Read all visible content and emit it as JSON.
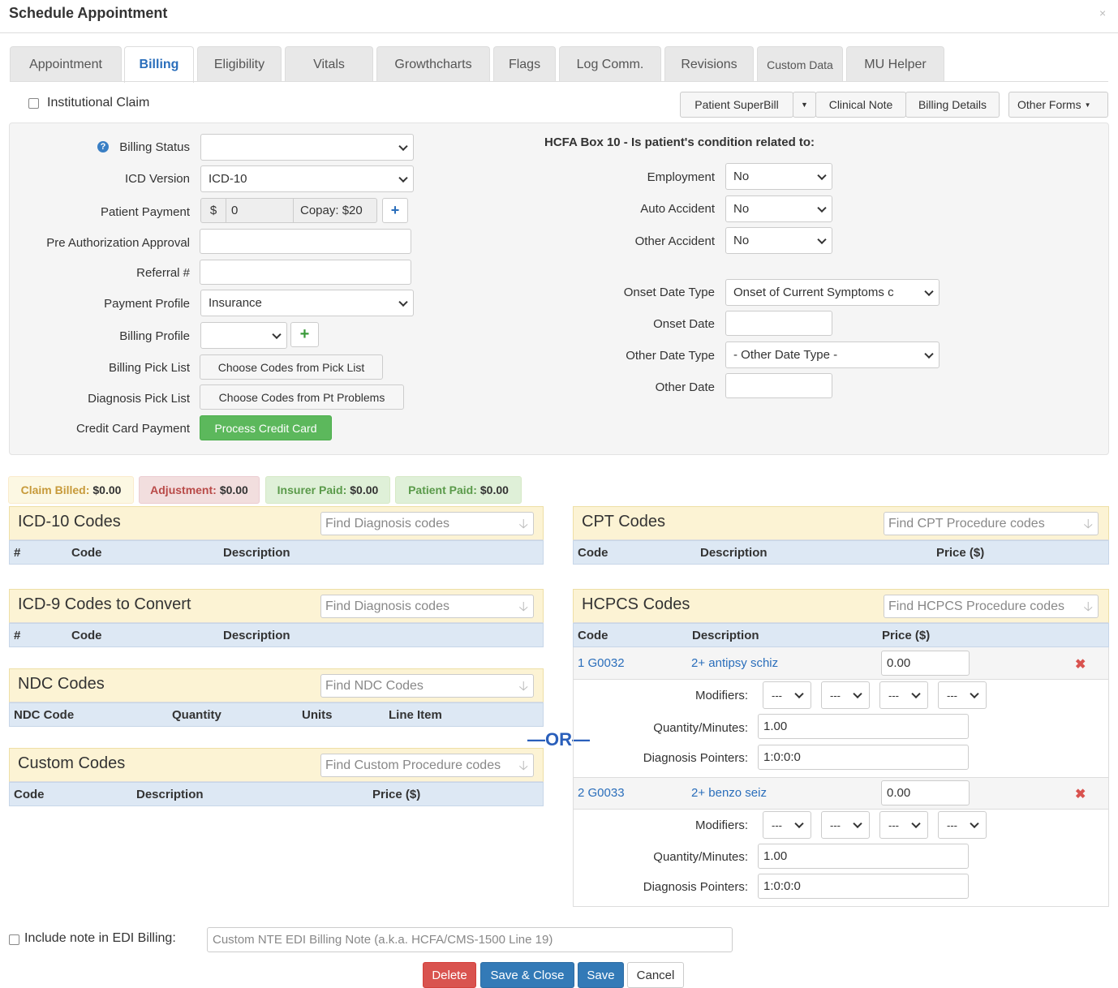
{
  "window": {
    "title": "Schedule Appointment",
    "close": "×"
  },
  "tabs": [
    {
      "label": "Appointment"
    },
    {
      "label": "Billing"
    },
    {
      "label": "Eligibility"
    },
    {
      "label": "Vitals"
    },
    {
      "label": "Growthcharts"
    },
    {
      "label": "Flags"
    },
    {
      "label": "Log Comm."
    },
    {
      "label": "Revisions"
    },
    {
      "label": "Custom Data"
    },
    {
      "label": "MU Helper"
    }
  ],
  "institutional_claim": "Institutional Claim",
  "toolbar": {
    "superbill": "Patient SuperBill",
    "clinical_note": "Clinical Note",
    "billing_details": "Billing Details",
    "other_forms": "Other Forms"
  },
  "form": {
    "billing_status": {
      "label": "Billing Status",
      "value": ""
    },
    "icd_version": {
      "label": "ICD Version",
      "value": "ICD-10"
    },
    "patient_payment": {
      "label": "Patient Payment",
      "currency": "$",
      "value": "0",
      "copay": "Copay: $20",
      "add": "+"
    },
    "pre_auth": {
      "label": "Pre Authorization Approval",
      "value": ""
    },
    "referral": {
      "label": "Referral #",
      "value": ""
    },
    "payment_profile": {
      "label": "Payment Profile",
      "value": "Insurance"
    },
    "billing_profile": {
      "label": "Billing Profile",
      "value": "",
      "add": "+"
    },
    "billing_pick_list": {
      "label": "Billing Pick List",
      "button": "Choose Codes from Pick List"
    },
    "diagnosis_pick_list": {
      "label": "Diagnosis Pick List",
      "button": "Choose Codes from Pt Problems"
    },
    "credit_card": {
      "label": "Credit Card Payment",
      "button": "Process Credit Card"
    }
  },
  "hcfa": {
    "heading": "HCFA Box 10 - Is patient's condition related to:",
    "employment": {
      "label": "Employment",
      "value": "No"
    },
    "auto_accident": {
      "label": "Auto Accident",
      "value": "No"
    },
    "other_accident": {
      "label": "Other Accident",
      "value": "No"
    },
    "onset_date_type": {
      "label": "Onset Date Type",
      "value": "Onset of Current Symptoms c"
    },
    "onset_date": {
      "label": "Onset Date",
      "value": ""
    },
    "other_date_type": {
      "label": "Other Date Type",
      "value": "- Other Date Type -"
    },
    "other_date": {
      "label": "Other Date",
      "value": ""
    }
  },
  "summary": {
    "claim_billed": {
      "label": "Claim Billed:",
      "value": "$0.00",
      "color": "#c79a3a"
    },
    "adjustment": {
      "label": "Adjustment:",
      "value": "$0.00",
      "color": "#b94a48"
    },
    "insurer_paid": {
      "label": "Insurer Paid:",
      "value": "$0.00",
      "color": "#5a9a4a"
    },
    "patient_paid": {
      "label": "Patient Paid:",
      "value": "$0.00",
      "color": "#5a9a4a"
    }
  },
  "icd10": {
    "title": "ICD-10 Codes",
    "placeholder": "Find Diagnosis codes",
    "cols": [
      "#",
      "Code",
      "Description"
    ]
  },
  "icd9": {
    "title": "ICD-9 Codes to Convert",
    "placeholder": "Find Diagnosis codes",
    "cols": [
      "#",
      "Code",
      "Description"
    ]
  },
  "ndc": {
    "title": "NDC Codes",
    "placeholder": "Find NDC Codes",
    "cols": [
      "NDC Code",
      "Quantity",
      "Units",
      "Line Item"
    ]
  },
  "custom": {
    "title": "Custom Codes",
    "placeholder": "Find Custom Procedure codes",
    "cols": [
      "Code",
      "Description",
      "Price ($)"
    ]
  },
  "or_label": "—OR—",
  "cpt": {
    "title": "CPT Codes",
    "placeholder": "Find CPT Procedure codes",
    "cols": [
      "Code",
      "Description",
      "Price ($)"
    ]
  },
  "hcpcs": {
    "title": "HCPCS Codes",
    "placeholder": "Find HCPCS Procedure codes",
    "cols": [
      "Code",
      "Description",
      "Price ($)"
    ],
    "modifiers_label": "Modifiers:",
    "quantity_label": "Quantity/Minutes:",
    "pointers_label": "Diagnosis Pointers:",
    "rows": [
      {
        "code": "1 G0032",
        "description": "2+ antipsy schiz",
        "price": "0.00",
        "modifiers": [
          "---",
          "---",
          "---",
          "---"
        ],
        "quantity": "1.00",
        "pointers": "1:0:0:0"
      },
      {
        "code": "2 G0033",
        "description": "2+ benzo seiz",
        "price": "0.00",
        "modifiers": [
          "---",
          "---",
          "---",
          "---"
        ],
        "quantity": "1.00",
        "pointers": "1:0:0:0"
      }
    ]
  },
  "edi": {
    "label": "Include note in EDI Billing:",
    "placeholder": "Custom NTE EDI Billing Note (a.k.a. HCFA/CMS-1500 Line 19)"
  },
  "footer": {
    "delete": "Delete",
    "save_close": "Save & Close",
    "save": "Save",
    "cancel": "Cancel"
  }
}
